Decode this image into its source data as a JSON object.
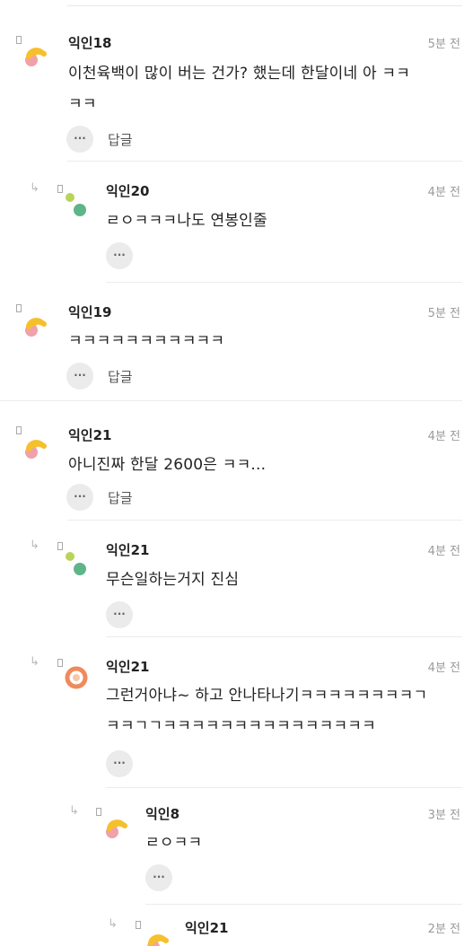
{
  "comments": [
    {
      "nick": "익인18",
      "time": "5분 전",
      "lines": [
        "이천육백이 많이 버는 건가? 했는데 한달이네 아 ㅋㅋ",
        "ㅋㅋ"
      ],
      "more": "···",
      "reply": "답글"
    },
    {
      "nick": "익인20",
      "time": "4분 전",
      "lines": [
        "ㄹㅇㅋㅋㅋ나도 연봉인줄"
      ],
      "more": "···"
    },
    {
      "nick": "익인19",
      "time": "5분 전",
      "lines": [
        "ㅋㅋㅋㅋㅋㅋㅋㅋㅋㅋㅋ"
      ],
      "more": "···",
      "reply": "답글"
    },
    {
      "nick": "익인21",
      "time": "4분 전",
      "lines": [
        "아니진짜 한달 2600은 ㅋㅋ..."
      ],
      "more": "···",
      "reply": "답글"
    },
    {
      "nick": "익인21",
      "time": "4분 전",
      "lines": [
        "무슨일하는거지 진심"
      ],
      "more": "···"
    },
    {
      "nick": "익인21",
      "time": "4분 전",
      "lines": [
        "그런거아냐~ 하고 안나타나기ㅋㅋㅋㅋㅋㅋㅋㅋㄱ",
        "ㅋㅋㄱㄱㅋㅋㅋㅋㅋㅋㅋㅋㅋㅋㅋㅋㅋㅋㅋ"
      ],
      "more": "···"
    },
    {
      "nick": "익인8",
      "time": "3분 전",
      "lines": [
        "ㄹㅇㅋㅋ"
      ],
      "more": "···"
    },
    {
      "nick": "익인21",
      "time": "2분 전"
    }
  ],
  "reply_arrow": "↳",
  "colors": {
    "yellow": "#f6c02d",
    "pink": "#f0a1a9",
    "green1": "#b9d45a",
    "green2": "#5fb58a",
    "orange": "#f08a5d"
  }
}
